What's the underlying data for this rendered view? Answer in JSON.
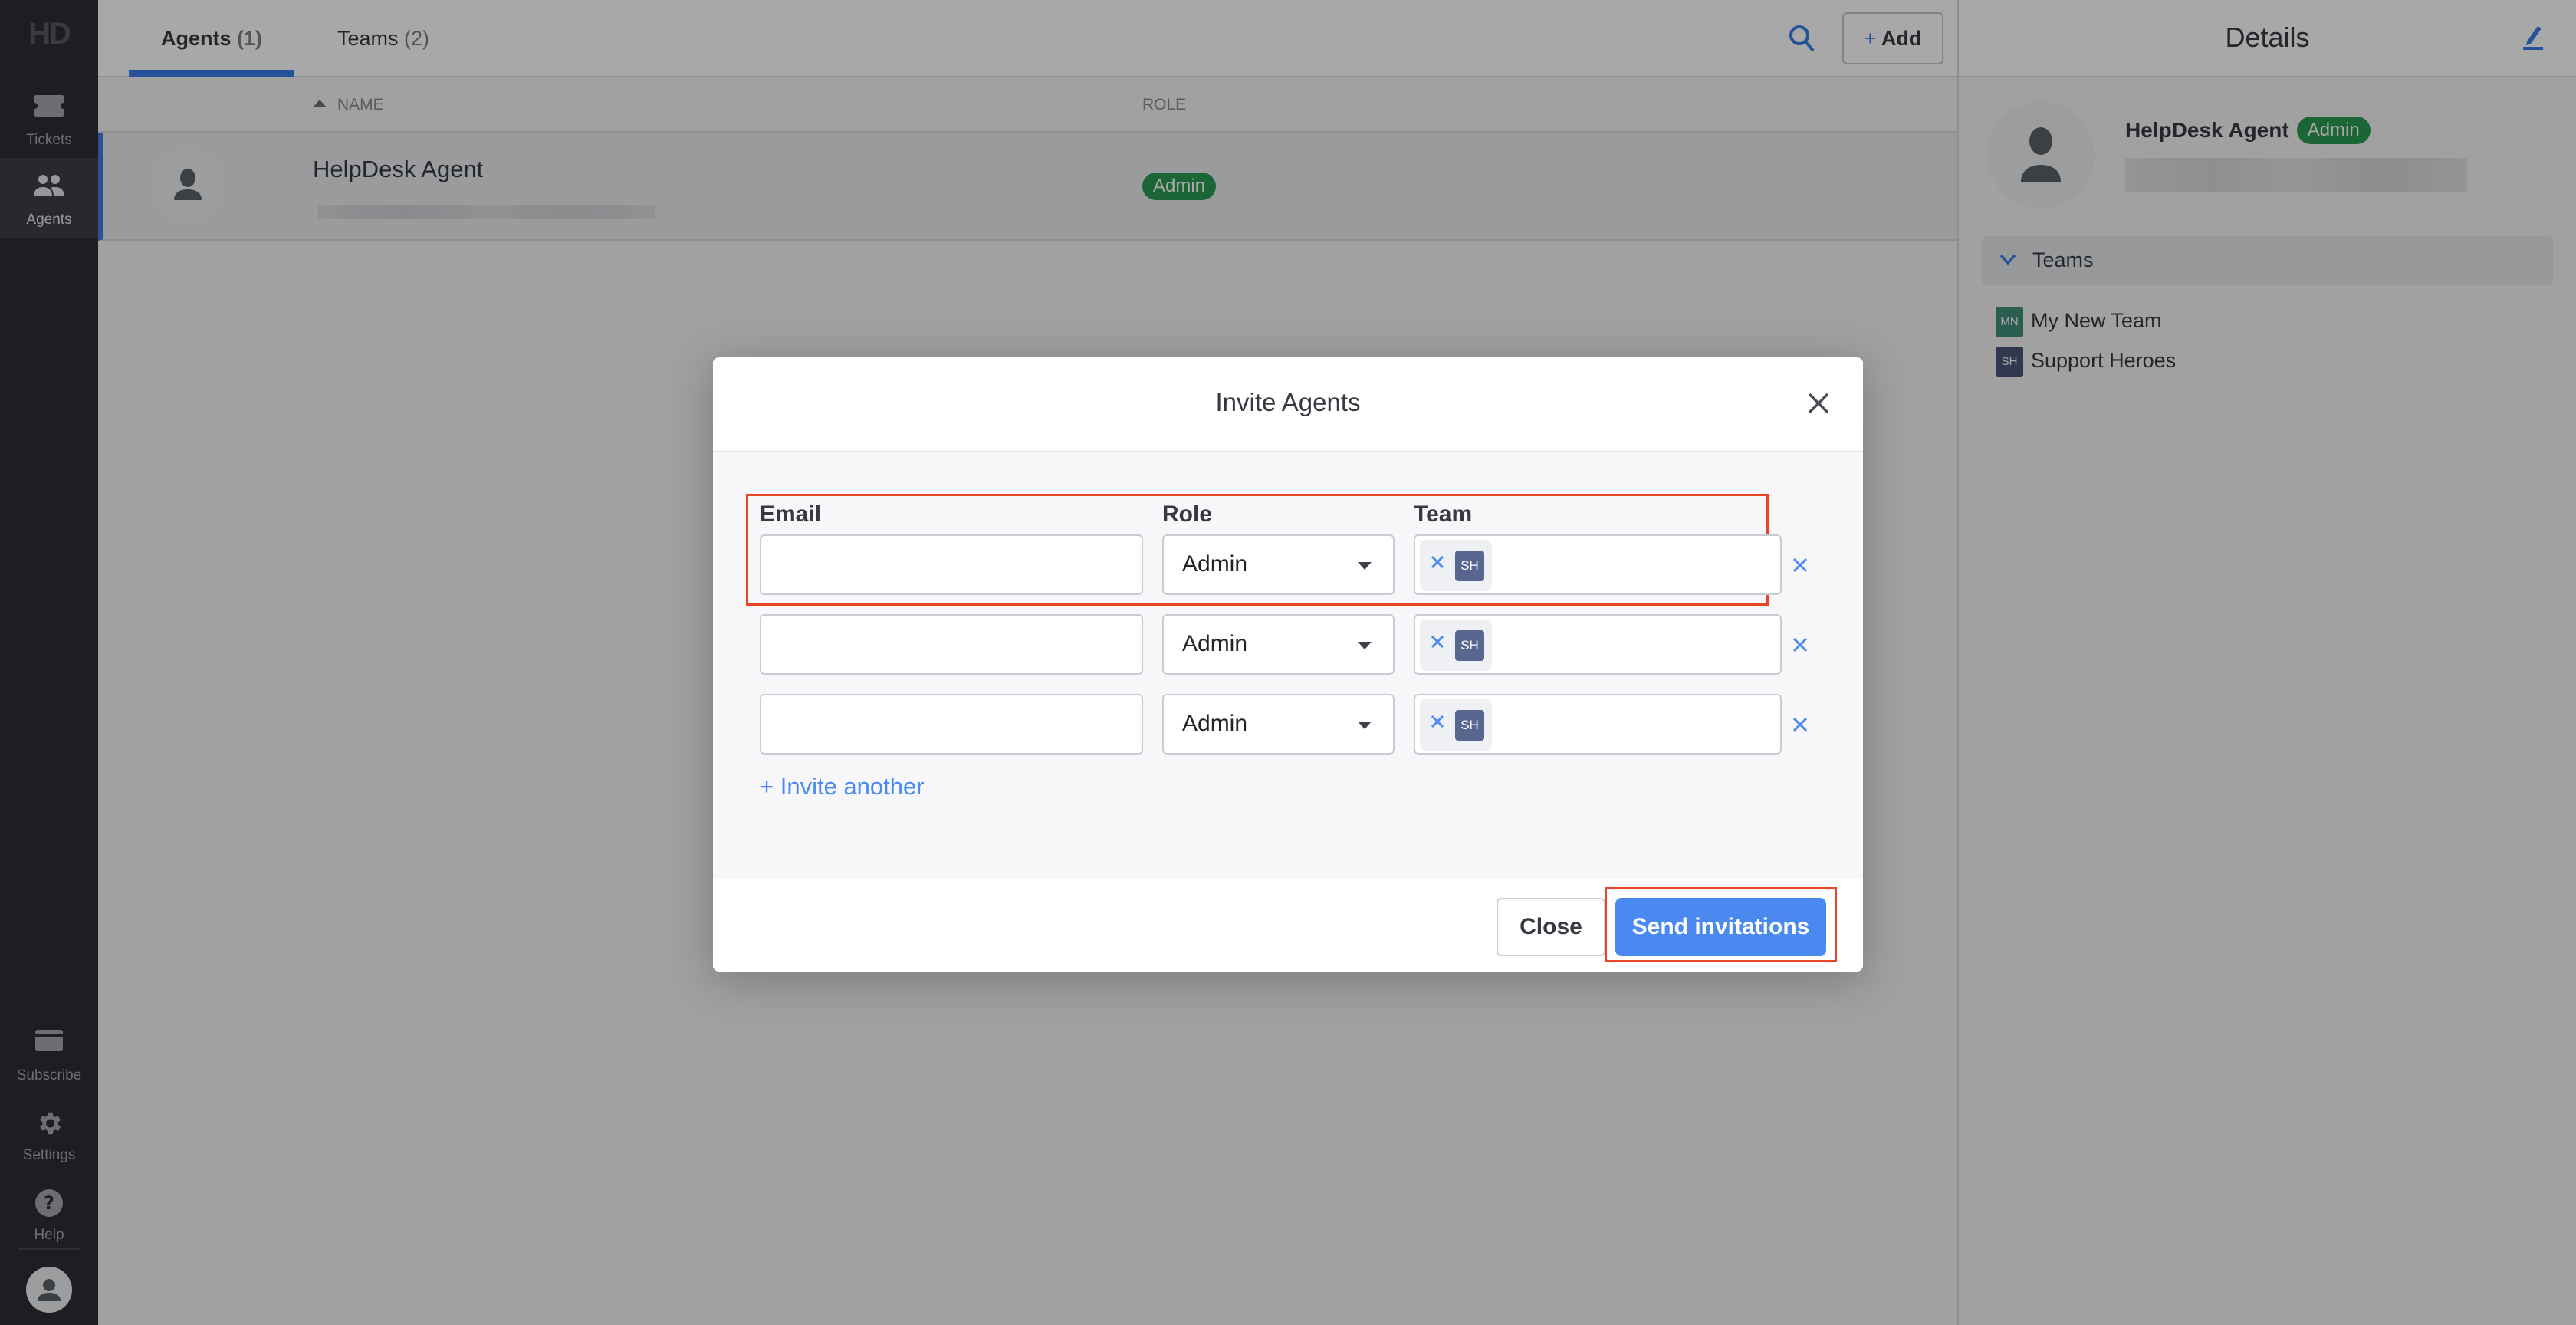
{
  "sidebar": {
    "logo": "HD",
    "items": [
      {
        "label": "Tickets",
        "icon": "ticket-icon"
      },
      {
        "label": "Agents",
        "icon": "agents-icon",
        "active": true
      },
      {
        "label": "Subscribe",
        "icon": "credit-card-icon"
      },
      {
        "label": "Settings",
        "icon": "gear-icon"
      },
      {
        "label": "Help",
        "icon": "help-icon"
      }
    ],
    "user_avatar": "user-avatar-icon"
  },
  "main": {
    "tabs": [
      {
        "label": "Agents",
        "count": "(1)",
        "active": true
      },
      {
        "label": "Teams",
        "count": "(2)",
        "active": false
      }
    ],
    "add_button": {
      "plus": "+",
      "label": "Add"
    },
    "columns": {
      "name": "NAME",
      "role": "ROLE"
    },
    "agents": [
      {
        "name": "HelpDesk Agent",
        "role": "Admin"
      }
    ]
  },
  "details": {
    "title": "Details",
    "agent_name": "HelpDesk Agent",
    "role_badge": "Admin",
    "teams_section": "Teams",
    "teams": [
      {
        "initials": "MN",
        "name": "My New Team",
        "color": "#3f8f7c"
      },
      {
        "initials": "SH",
        "name": "Support Heroes",
        "color": "#4a5478"
      }
    ]
  },
  "modal": {
    "title": "Invite Agents",
    "labels": {
      "email": "Email",
      "role": "Role",
      "team": "Team"
    },
    "rows": [
      {
        "email": "",
        "role": "Admin",
        "team_chip": "SH"
      },
      {
        "email": "",
        "role": "Admin",
        "team_chip": "SH"
      },
      {
        "email": "",
        "role": "Admin",
        "team_chip": "SH"
      }
    ],
    "invite_another": "+ Invite another",
    "close_label": "Close",
    "send_label": "Send invitations"
  },
  "colors": {
    "accent": "#4a8af0",
    "admin_badge": "#2a9a54",
    "highlight": "#e8442a",
    "sidebar_bg": "#302d35"
  }
}
